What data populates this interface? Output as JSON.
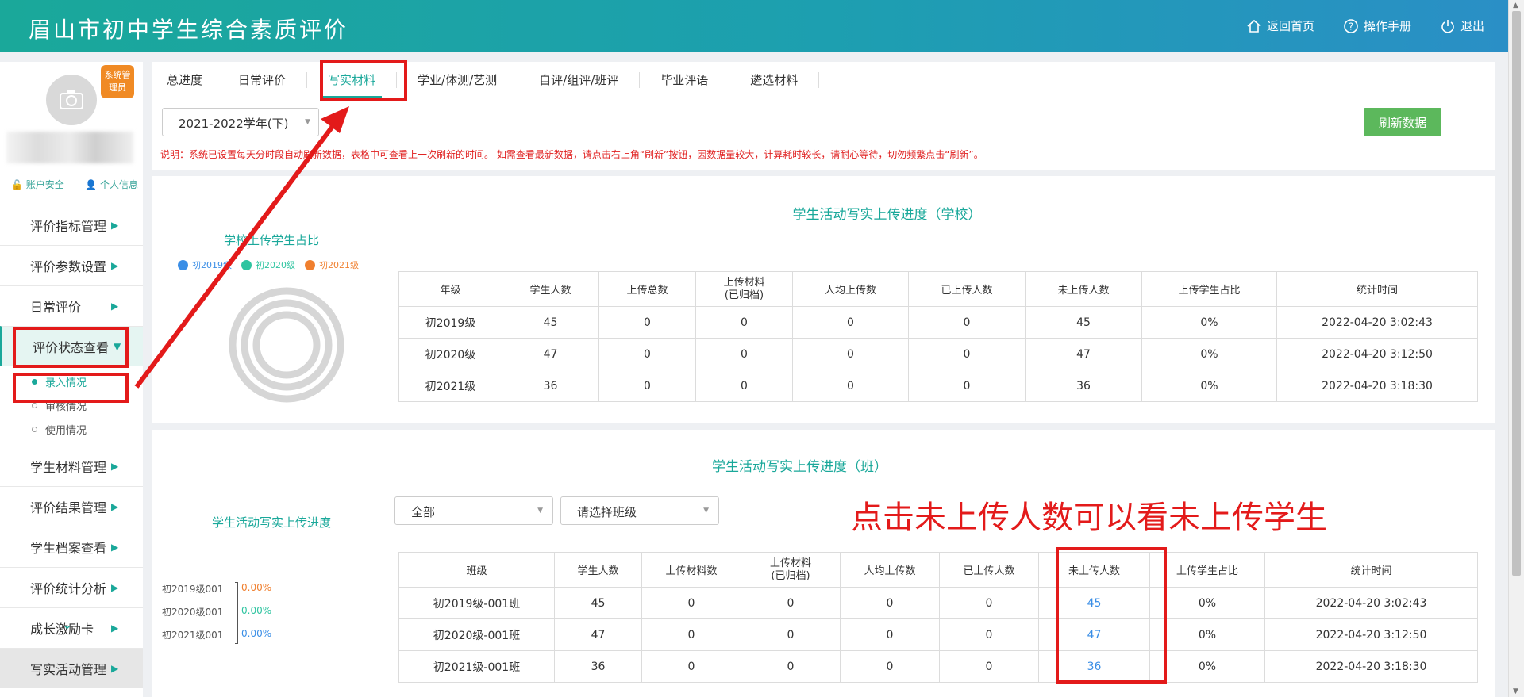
{
  "header": {
    "title": "眉山市初中学生综合素质评价",
    "nav": [
      "返回首页",
      "操作手册",
      "退出"
    ]
  },
  "sidebar": {
    "role_badge": "系统管理员",
    "account_security": "账户安全",
    "personal_info": "个人信息",
    "menu": [
      "评价指标管理",
      "评价参数设置",
      "日常评价",
      "评价状态查看",
      "学生材料管理",
      "评价结果管理",
      "学生档案查看",
      "评价统计分析",
      "成长激励卡",
      "写实活动管理"
    ],
    "submenu": [
      "录入情况",
      "审核情况",
      "使用情况"
    ]
  },
  "tabs": [
    "总进度",
    "日常评价",
    "写实材料",
    "学业/体测/艺测",
    "自评/组评/班评",
    "毕业评语",
    "遴选材料"
  ],
  "year_select": "2021-2022学年(下)",
  "refresh_label": "刷新数据",
  "note": "说明：系统已设置每天分时段自动刷新数据，表格中可查看上一次刷新的时间。 如需查看最新数据，请点击右上角“刷新”按钮，因数据量较大，计算耗时较长，请耐心等待，切勿频繁点击“刷新”。",
  "school": {
    "title": "学生活动写实上传进度（学校）",
    "chart_title": "学校上传学生占比",
    "legend": [
      "初2019级",
      "初2020级",
      "初2021级"
    ],
    "legend_colors": [
      "#3a8ee6",
      "#2ec4a0",
      "#f07f2e"
    ],
    "headers": [
      "年级",
      "学生人数",
      "上传总数",
      "上传材料\n(已归档)",
      "人均上传数",
      "已上传人数",
      "未上传人数",
      "上传学生占比",
      "统计时间"
    ],
    "rows": [
      [
        "初2019级",
        "45",
        "0",
        "0",
        "0",
        "0",
        "45",
        "0%",
        "2022-04-20 3:02:43"
      ],
      [
        "初2020级",
        "47",
        "0",
        "0",
        "0",
        "0",
        "47",
        "0%",
        "2022-04-20 3:12:50"
      ],
      [
        "初2021级",
        "36",
        "0",
        "0",
        "0",
        "0",
        "36",
        "0%",
        "2022-04-20 3:18:30"
      ]
    ]
  },
  "class": {
    "title": "学生活动写实上传进度（班）",
    "chart_title": "学生活动写实上传进度",
    "grade_select": "全部",
    "class_select": "请选择班级",
    "callout": "点击未上传人数可以看未上传学生",
    "bar_labels": [
      "初2019级001",
      "初2020级001",
      "初2021级001"
    ],
    "bar_values": [
      "0.00%",
      "0.00%",
      "0.00%"
    ],
    "headers": [
      "班级",
      "学生人数",
      "上传材料数",
      "上传材料\n(已归档)",
      "人均上传数",
      "已上传人数",
      "未上传人数",
      "上传学生占比",
      "统计时间"
    ],
    "rows": [
      [
        "初2019级-001班",
        "45",
        "0",
        "0",
        "0",
        "0",
        "45",
        "0%",
        "2022-04-20 3:02:43"
      ],
      [
        "初2020级-001班",
        "47",
        "0",
        "0",
        "0",
        "0",
        "47",
        "0%",
        "2022-04-20 3:12:50"
      ],
      [
        "初2021级-001班",
        "36",
        "0",
        "0",
        "0",
        "0",
        "36",
        "0%",
        "2022-04-20 3:18:30"
      ]
    ]
  }
}
